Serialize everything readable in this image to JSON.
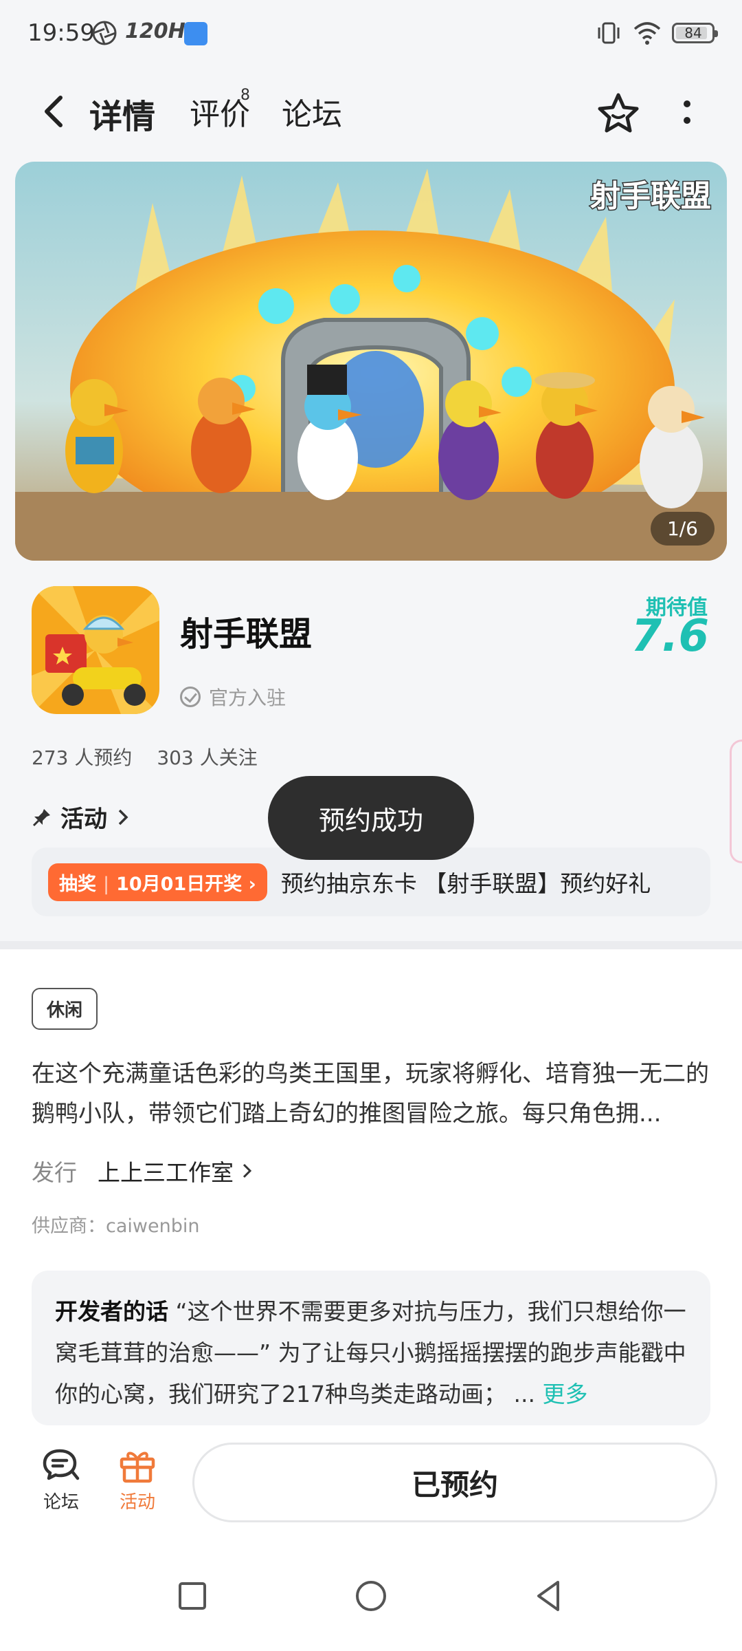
{
  "status_bar": {
    "time": "19:59",
    "refresh_rate": "120Hz",
    "battery": "84"
  },
  "header": {
    "tabs": [
      {
        "label": "详情",
        "active": true
      },
      {
        "label": "评价",
        "badge": "8"
      },
      {
        "label": "论坛"
      }
    ]
  },
  "banner": {
    "logo_text": "射手联盟",
    "counter": "1/6"
  },
  "app": {
    "name": "射手联盟",
    "official_label": "官方入驻",
    "expect_label": "期待值",
    "expect_value": "7.6",
    "reservations": "273 人预约",
    "followers": "303 人关注"
  },
  "activity": {
    "title": "活动",
    "tag_type": "抽奖",
    "tag_date": "10月01日开奖",
    "text": "预约抽京东卡 【射手联盟】预约好礼"
  },
  "details": {
    "category_tag": "休闲",
    "description": "在这个充满童话色彩的鸟类王国里，玩家将孵化、培育独一无二的鹅鸭小队，带领它们踏上奇幻的推图冒险之旅。每只角色拥...",
    "publisher_label": "发行",
    "publisher_value": "上上三工作室",
    "supplier": "供应商：caiwenbin",
    "dev_words_label": "开发者的话",
    "dev_words_text": "“这个世界不需要更多对抗与压力，我们只想给你一窝毛茸茸的治愈——” 为了让每只小鹅摇摇摆摆的跑步声能戳中你的心窝，我们研究了217种鸟类走路动画； ...",
    "more_label": "更多"
  },
  "bottom_bar": {
    "forum_label": "论坛",
    "activity_label": "活动",
    "reserved_label": "已预约"
  },
  "toast": {
    "text": "预约成功"
  },
  "colors": {
    "accent": "#1fc0b3",
    "orange": "#ff6a33"
  }
}
